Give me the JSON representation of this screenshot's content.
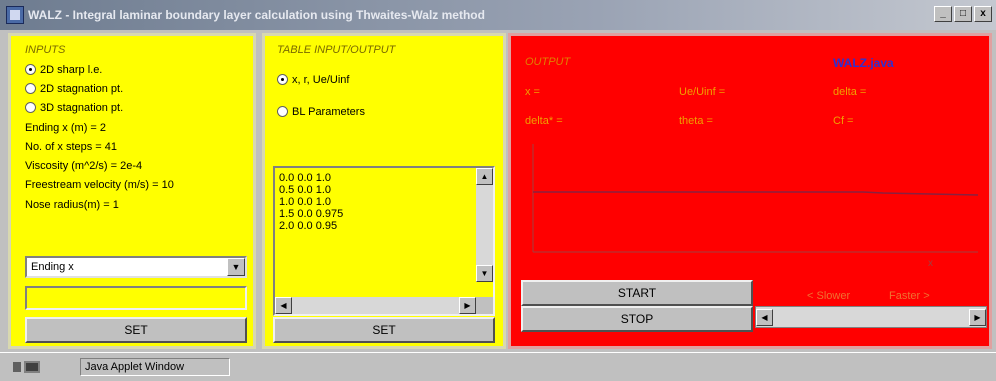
{
  "window": {
    "title": "WALZ - Integral laminar boundary layer calculation using Thwaites-Walz method",
    "minimize": "_",
    "maximize": "□",
    "close": "x"
  },
  "inputs": {
    "heading": "INPUTS",
    "options": [
      "2D sharp l.e.",
      "2D stagnation pt.",
      "3D stagnation pt."
    ],
    "selected_option": 0,
    "ending": "Ending x (m) = 2",
    "steps": "No. of x steps = 41",
    "viscosity": "Viscosity (m^2/s) = 2e-4",
    "velocity": "Freestream velocity (m/s) = 10",
    "nose": "Nose radius(m) = 1",
    "select_value": "Ending x",
    "text_value": "",
    "set_label": "SET"
  },
  "table": {
    "heading": "TABLE INPUT/OUTPUT",
    "options": [
      "x, r, Ue/Uinf",
      "BL Parameters"
    ],
    "selected_option": 0,
    "rows": [
      "0.0 0.0 1.0",
      "0.5 0.0 1.0",
      "1.0 0.0 1.0",
      "1.5 0.0 0.975",
      "2.0 0.0 0.95"
    ],
    "set_label": "SET"
  },
  "output": {
    "heading": "OUTPUT",
    "title": "WALZ.java",
    "x_label": "x =",
    "ue_label": "Ue/Uinf =",
    "delta_label": "delta =",
    "delta_star_label": "delta* =",
    "theta_label": "theta =",
    "cf_label": "Cf =",
    "axis_marker": "x",
    "start_label": "START",
    "stop_label": "STOP",
    "slower_label": "< Slower",
    "faster_label": "Faster >"
  },
  "status": {
    "text": "Java Applet Window"
  },
  "colors": {
    "inputs_bg": "#ffff00",
    "output_bg": "#ff0000",
    "title_accent": "#3030d0"
  }
}
